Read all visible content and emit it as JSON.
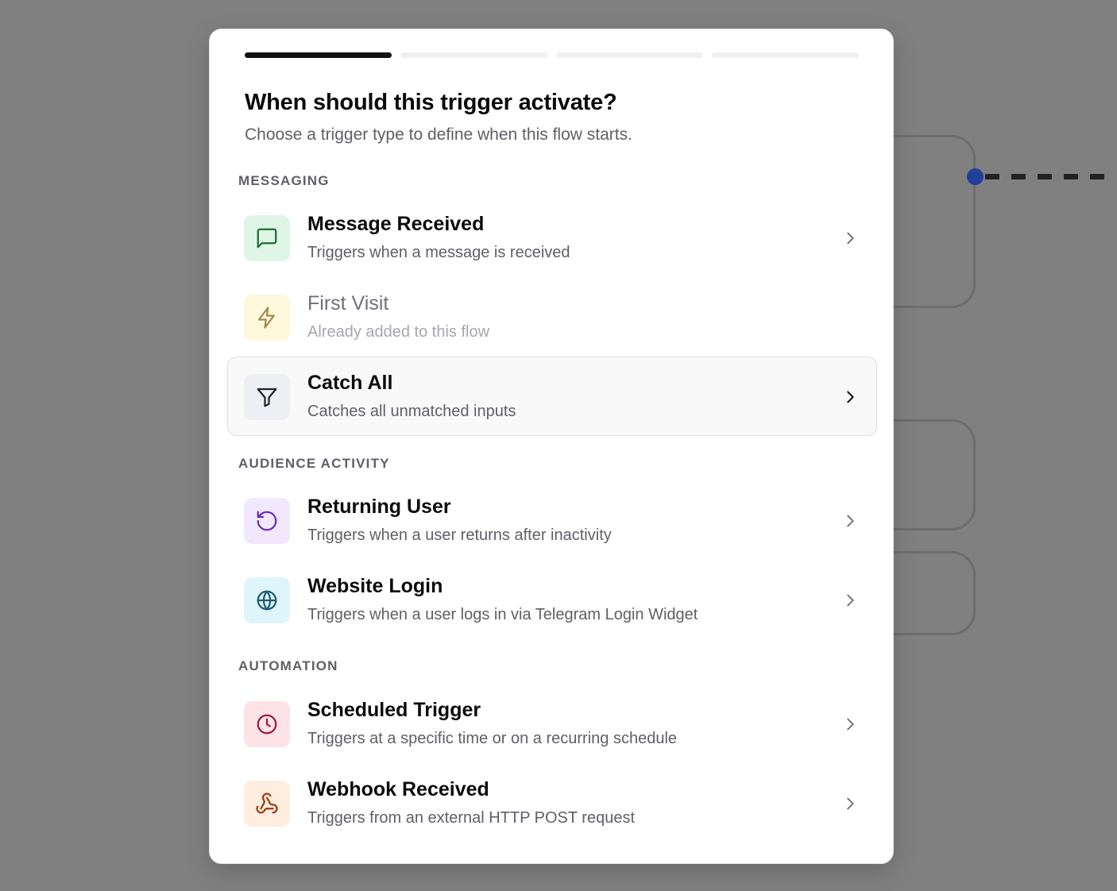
{
  "dialog": {
    "title": "When should this trigger activate?",
    "subtitle": "Choose a trigger type to define when this flow starts.",
    "steps": {
      "total": 4,
      "current": 1
    }
  },
  "sections": [
    {
      "label": "MESSAGING",
      "items": [
        {
          "title": "Message Received",
          "description": "Triggers when a message is received",
          "icon": "message-square-icon",
          "icon_color": "#1f6b34",
          "icon_bg": "#dff6e6",
          "disabled": false,
          "hovered": false
        },
        {
          "title": "First Visit",
          "description": "Already added to this flow",
          "icon": "lightning-icon",
          "icon_color": "#a08a4f",
          "icon_bg": "#fdf7db",
          "disabled": true,
          "hovered": false
        },
        {
          "title": "Catch All",
          "description": "Catches all unmatched inputs",
          "icon": "funnel-icon",
          "icon_color": "#1e2430",
          "icon_bg": "#eeeff2",
          "disabled": false,
          "hovered": true
        }
      ]
    },
    {
      "label": "AUDIENCE ACTIVITY",
      "items": [
        {
          "title": "Returning User",
          "description": "Triggers when a user returns after inactivity",
          "icon": "rotate-ccw-icon",
          "icon_color": "#6a2bc4",
          "icon_bg": "#f2e8fd",
          "disabled": false,
          "hovered": false
        },
        {
          "title": "Website Login",
          "description": "Triggers when a user logs in via Telegram Login Widget",
          "icon": "globe-icon",
          "icon_color": "#1d5a74",
          "icon_bg": "#def6fb",
          "disabled": false,
          "hovered": false
        }
      ]
    },
    {
      "label": "AUTOMATION",
      "items": [
        {
          "title": "Scheduled Trigger",
          "description": "Triggers at a specific time or on a recurring schedule",
          "icon": "clock-icon",
          "icon_color": "#9c1b3d",
          "icon_bg": "#fde3e6",
          "disabled": false,
          "hovered": false
        },
        {
          "title": "Webhook Received",
          "description": "Triggers from an external HTTP POST request",
          "icon": "webhook-icon",
          "icon_color": "#9c3a12",
          "icon_bg": "#fdeedf",
          "disabled": false,
          "hovered": false
        }
      ]
    }
  ],
  "colors": {
    "overlay": "#808080",
    "modal_bg": "#ffffff",
    "active_step": "#111111",
    "inactive_step": "#f0f0f2",
    "canvas_dot": "#1f3f99"
  }
}
